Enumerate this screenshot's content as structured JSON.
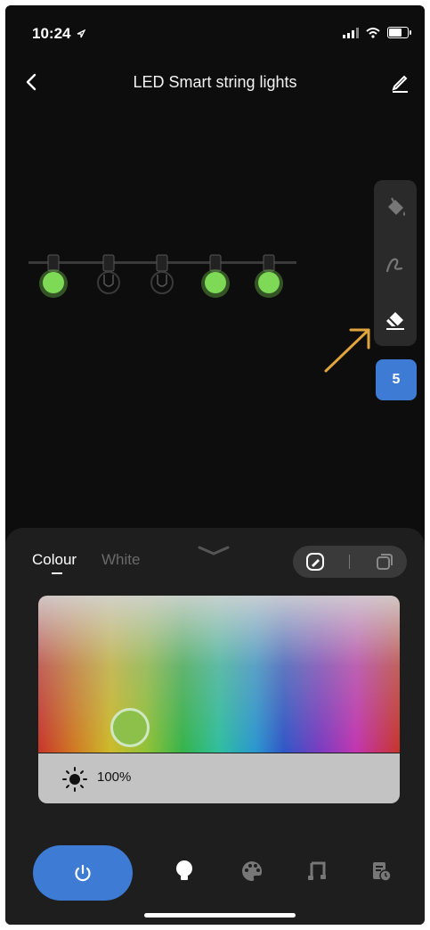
{
  "status_bar": {
    "time": "10:24"
  },
  "header": {
    "title": "LED Smart string lights"
  },
  "string": {
    "bulbs": [
      "on",
      "off",
      "off",
      "on",
      "on"
    ],
    "on_color": "#7ed957"
  },
  "tools": {
    "items": [
      "fill-bucket-icon",
      "brush-icon",
      "eraser-icon"
    ],
    "count": "5"
  },
  "panel": {
    "tabs": [
      {
        "label": "Colour",
        "active": true
      },
      {
        "label": "White",
        "active": false
      }
    ],
    "brightness_label": "100%",
    "selected_color": "#8dc04a",
    "accent": "#3d7bd4"
  },
  "nav": {
    "items": [
      "power-icon",
      "bulb-icon",
      "palette-icon",
      "music-icon",
      "schedule-icon"
    ]
  }
}
